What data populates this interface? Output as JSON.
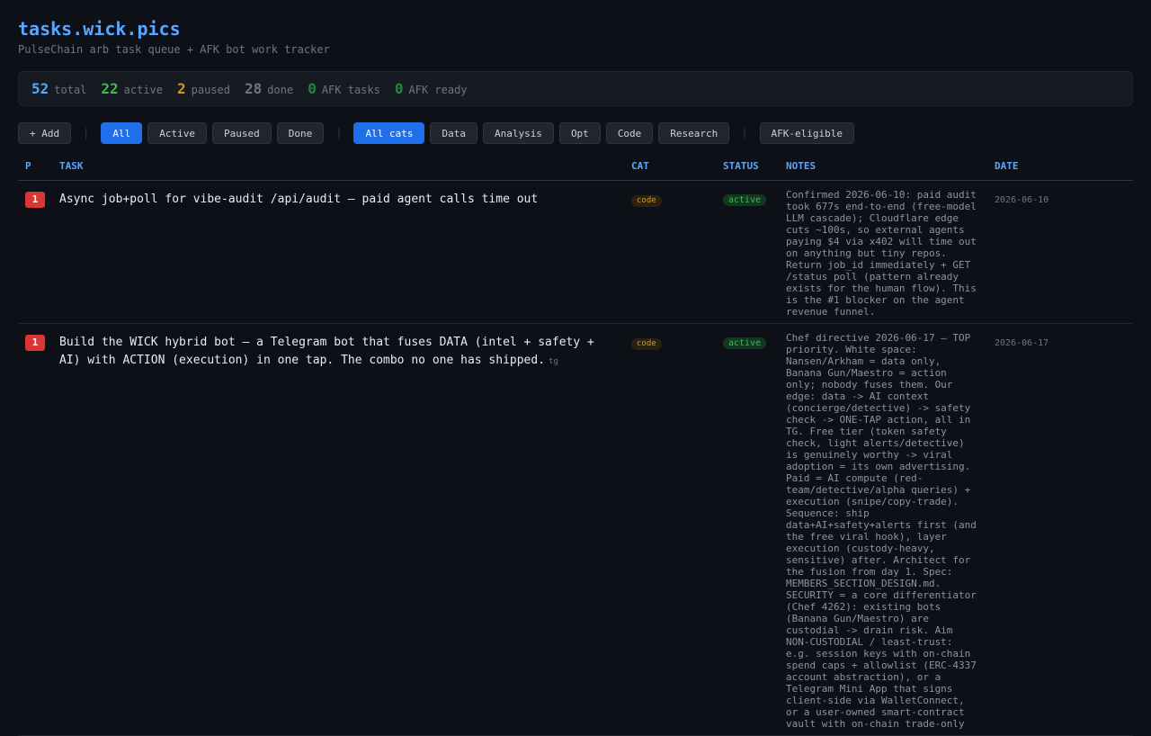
{
  "header": {
    "title": "tasks.wick.pics",
    "subtitle": "PulseChain arb task queue + AFK bot work tracker"
  },
  "stats": [
    {
      "value": "52",
      "label": "total"
    },
    {
      "value": "22",
      "label": "active"
    },
    {
      "value": "2",
      "label": "paused"
    },
    {
      "value": "28",
      "label": "done"
    },
    {
      "value": "0",
      "label": "AFK tasks"
    },
    {
      "value": "0",
      "label": "AFK ready"
    }
  ],
  "toolbar": {
    "add": "+ Add",
    "status_filters": [
      "All",
      "Active",
      "Paused",
      "Done"
    ],
    "cat_filters": [
      "All cats",
      "Data",
      "Analysis",
      "Opt",
      "Code",
      "Research"
    ],
    "afk": "AFK-eligible"
  },
  "table": {
    "headers": {
      "p": "P",
      "task": "TASK",
      "cat": "CAT",
      "status": "STATUS",
      "notes": "NOTES",
      "date": "DATE"
    },
    "rows": [
      {
        "priority": "1",
        "task": "Async job+poll for vibe-audit /api/audit — paid agent calls time out",
        "tag": "",
        "cat": "code",
        "status": "active",
        "notes": "Confirmed 2026-06-10: paid audit took 677s end-to-end (free-model LLM cascade); Cloudflare edge cuts ~100s, so external agents paying $4 via x402 will time out on anything but tiny repos. Return job_id immediately + GET /status poll (pattern already exists for the human flow). This is the #1 blocker on the agent revenue funnel.",
        "date": "2026-06-10"
      },
      {
        "priority": "1",
        "task": "Build the WICK hybrid bot — a Telegram bot that fuses DATA (intel + safety + AI) with ACTION (execution) in one tap. The combo no one has shipped.",
        "tag": "tg",
        "cat": "code",
        "status": "active",
        "notes": "Chef directive 2026-06-17 — TOP priority. White space: Nansen/Arkham = data only, Banana Gun/Maestro = action only; nobody fuses them. Our edge: data -> AI context (concierge/detective) -> safety check -> ONE-TAP action, all in TG. Free tier (token safety check, light alerts/detective) is genuinely worthy -> viral adoption = its own advertising. Paid = AI compute (red-team/detective/alpha queries) + execution (snipe/copy-trade). Sequence: ship data+AI+safety+alerts first (and the free viral hook), layer execution (custody-heavy, sensitive) after. Architect for the fusion from day 1. Spec: MEMBERS_SECTION_DESIGN.md. SECURITY = a core differentiator (Chef 4262): existing bots (Banana Gun/Maestro) are custodial -> drain risk. Aim NON-CUSTODIAL / least-trust: e.g. session keys with on-chain spend caps + allowlist (ERC-4337 account abstraction), or a Telegram Mini App that signs client-side via WalletConnect, or a user-owned smart-contract vault with on-chain trade-only",
        "date": "2026-06-17"
      }
    ]
  }
}
